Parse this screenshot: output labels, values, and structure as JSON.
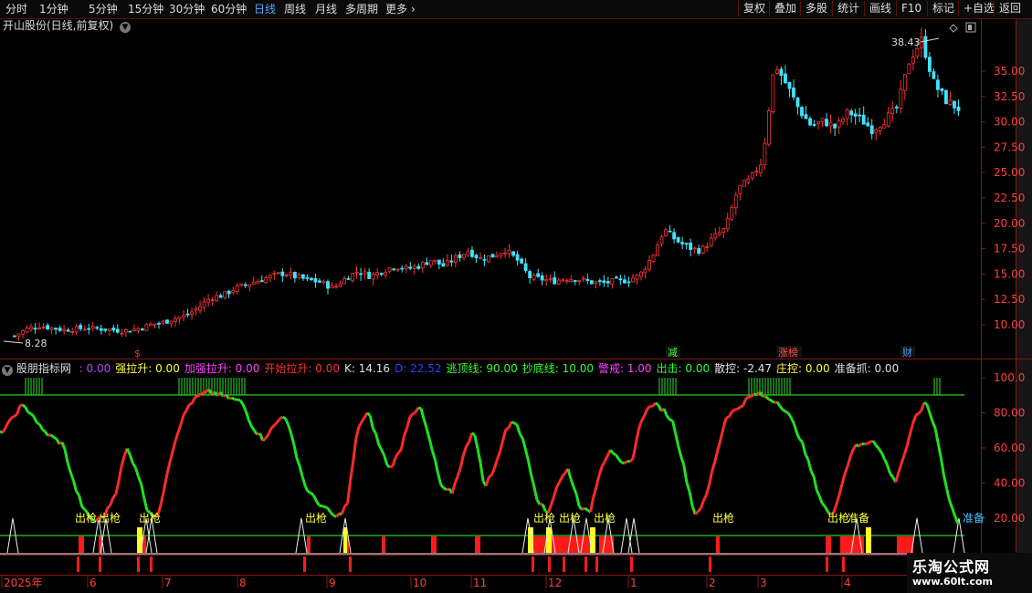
{
  "toolbar": {
    "periods": [
      "分时",
      "1分钟",
      "5分钟",
      "15分钟",
      "30分钟",
      "60分钟",
      "日线",
      "周线",
      "月线",
      "多周期",
      "更多"
    ],
    "active_period": "日线",
    "right_buttons": [
      "复权",
      "叠加",
      "多股",
      "统计",
      "画线",
      "F10",
      "标记",
      "+自选",
      "返回"
    ]
  },
  "stock": {
    "title": "开山股份(日线,前复权)",
    "high_label": "38.43",
    "low_label": "8.28"
  },
  "price_axis": [
    "35.00",
    "32.50",
    "30.00",
    "27.50",
    "25.00",
    "22.50",
    "20.00",
    "17.50",
    "15.00",
    "12.50",
    "10.00"
  ],
  "event_markers": [
    "减",
    "涨榜",
    "财"
  ],
  "indicator": {
    "name": "股朋指标网",
    "items": [
      {
        "text": ": 0.00",
        "color": "#c040ff"
      },
      {
        "text": "强拉升: 0.00",
        "color": "#ffff40"
      },
      {
        "text": "加强拉升: 0.00",
        "color": "#ff40ff"
      },
      {
        "text": "开始拉升: 0.00",
        "color": "#ff3030"
      },
      {
        "text": "K: 14.16",
        "color": "#e0e0e0"
      },
      {
        "text": "D: 22.52",
        "color": "#3040ff"
      },
      {
        "text": "逃顶线: 90.00",
        "color": "#30ff30"
      },
      {
        "text": "抄底线: 10.00",
        "color": "#30ff30"
      },
      {
        "text": "警戒: 1.00",
        "color": "#ff40ff"
      },
      {
        "text": "出击: 0.00",
        "color": "#30ff30"
      },
      {
        "text": "散控: -2.47",
        "color": "#e0e0e0"
      },
      {
        "text": "庄控: 0.00",
        "color": "#ffff40"
      },
      {
        "text": "准备抓: 0.00",
        "color": "#e0e0e0"
      }
    ]
  },
  "indicator_axis": [
    "100.0",
    "80.00",
    "60.00",
    "40.00",
    "20.00"
  ],
  "signal_label": "出枪",
  "signal_label_last": "准备",
  "time_axis": [
    "2025年",
    "6",
    "7",
    "8",
    "9",
    "10",
    "11",
    "12",
    "1",
    "2",
    "3",
    "4"
  ],
  "watermark": {
    "title": "乐淘公式网",
    "url": "www.60lt.com"
  },
  "colors": {
    "up": "#ff3232",
    "down": "#3de4ff",
    "grid": "#8a1414",
    "kdj_up": "#ff2a2a",
    "kdj_down": "#20e020"
  },
  "chart_data": [
    {
      "type": "candlestick",
      "title": "开山股份(日线,前复权)",
      "y_axis": [
        10.0,
        12.5,
        15.0,
        17.5,
        20.0,
        22.5,
        25.0,
        27.5,
        30.0,
        32.5,
        35.0
      ],
      "annotations": {
        "high": 38.43,
        "low": 8.28
      },
      "close_path": [
        8.9,
        9.6,
        9.9,
        9.7,
        9.5,
        9.6,
        9.7,
        9.6,
        9.5,
        9.4,
        9.6,
        10.0,
        10.2,
        10.6,
        10.9,
        11.7,
        12.7,
        12.9,
        13.6,
        14.0,
        14.4,
        14.8,
        15.1,
        14.7,
        14.4,
        14.2,
        13.6,
        14.6,
        15.3,
        14.8,
        15.3,
        15.8,
        15.5,
        15.8,
        16.4,
        15.8,
        16.6,
        17.3,
        16.5,
        16.8,
        17.4,
        16.4,
        14.7,
        14.5,
        14.3,
        14.6,
        14.5,
        14.2,
        14.1,
        14.3,
        14.4,
        14.9,
        16.7,
        19.4,
        18.3,
        17.6,
        17.3,
        18.6,
        19.5,
        23.4,
        24.3,
        26.2,
        35.8,
        33.6,
        31.2,
        29.6,
        30.1,
        29.4,
        31.0,
        30.3,
        29.2,
        30.2,
        31.4,
        36.1,
        38.1,
        33.8,
        32.1,
        31.3
      ]
    },
    {
      "type": "line",
      "title": "股朋指标网",
      "y_axis": [
        20,
        40,
        60,
        80,
        100
      ],
      "reference_lines": {
        "逃顶线": 90,
        "抄底线": 10
      },
      "kdj_path": [
        68,
        75,
        84,
        80,
        70,
        66,
        62,
        40,
        24,
        18,
        22,
        35,
        60,
        48,
        25,
        20,
        50,
        72,
        85,
        90,
        92,
        90,
        88,
        86,
        72,
        65,
        72,
        80,
        60,
        38,
        30,
        25,
        20,
        28,
        72,
        80,
        62,
        48,
        58,
        80,
        82,
        60,
        36,
        35,
        55,
        72,
        38,
        48,
        70,
        76,
        58,
        32,
        22,
        40,
        48,
        28,
        22,
        48,
        60,
        50,
        52,
        78,
        85,
        82,
        74,
        48,
        22,
        30,
        55,
        78,
        82,
        88,
        91,
        88,
        86,
        78,
        66,
        48,
        30,
        20,
        40,
        60,
        62,
        65,
        54,
        40,
        58,
        78,
        86,
        68,
        34,
        16
      ]
    }
  ]
}
